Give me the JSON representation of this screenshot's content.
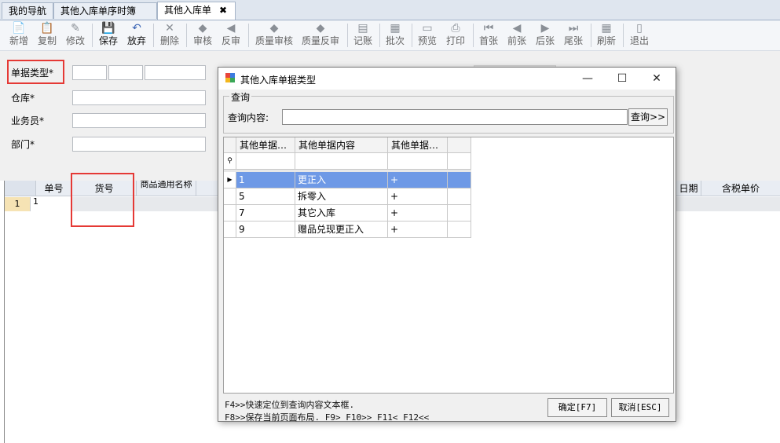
{
  "tabs": [
    {
      "label": "我的导航"
    },
    {
      "label": "其他入库单序时簿"
    },
    {
      "label": "其他入库单",
      "close": "✖"
    }
  ],
  "toolbar": {
    "buttons": [
      {
        "label": "新增",
        "icon": "📄"
      },
      {
        "label": "复制",
        "icon": "📋"
      },
      {
        "label": "修改",
        "icon": "✎"
      },
      {
        "label": "保存",
        "icon": "💾"
      },
      {
        "label": "放弃",
        "icon": "↶"
      },
      {
        "label": "删除",
        "icon": "✕"
      },
      {
        "label": "审核",
        "icon": "◆"
      },
      {
        "label": "反审",
        "icon": "◀"
      },
      {
        "label": "质量审核",
        "icon": "◆"
      },
      {
        "label": "质量反审",
        "icon": "◆"
      },
      {
        "label": "记账",
        "icon": "▤"
      },
      {
        "label": "批次",
        "icon": "▦"
      },
      {
        "label": "预览",
        "icon": "▭"
      },
      {
        "label": "打印",
        "icon": "⎙"
      },
      {
        "label": "首张",
        "icon": "⏮"
      },
      {
        "label": "前张",
        "icon": "◀"
      },
      {
        "label": "后张",
        "icon": "▶"
      },
      {
        "label": "尾张",
        "icon": "⏭"
      },
      {
        "label": "刷新",
        "icon": "▦"
      },
      {
        "label": "退出",
        "icon": "▯"
      }
    ]
  },
  "form": {
    "doc_type_label": "单据类型*",
    "warehouse_label": "仓库*",
    "clerk_label": "业务员*",
    "dept_label": "部门*"
  },
  "grid": {
    "columns": [
      "单号",
      "货号",
      "商品通用名称",
      "日期",
      "含税单价"
    ],
    "rows": [
      {
        "num": "1",
        "id": "1"
      }
    ]
  },
  "dialog": {
    "title": "其他入库单据类型",
    "window_controls": {
      "minimize": "—",
      "maximize": "☐",
      "close": "✕"
    },
    "group_title": "查询",
    "search_label": "查询内容:",
    "search_value": "",
    "search_button": "查询>>",
    "columns": [
      "其他单据…",
      "其他单据内容",
      "其他单据…"
    ],
    "rows": [
      {
        "code": "1",
        "content": "更正入",
        "flag": "+"
      },
      {
        "code": "5",
        "content": "拆零入",
        "flag": "+"
      },
      {
        "code": "7",
        "content": "其它入库",
        "flag": "+"
      },
      {
        "code": "9",
        "content": "赠品兑现更正入",
        "flag": "+"
      }
    ],
    "hints": [
      "F4>>快速定位到查询内容文本框.",
      "F8>>保存当前页面布局. F9> F10>> F11< F12<<"
    ],
    "ok_button": "确定[F7]",
    "cancel_button": "取消[ESC]"
  },
  "colors": {
    "highlight_red": "#e53935",
    "selection_blue": "#6e99e6",
    "accent_blue": "#3d66b5"
  }
}
